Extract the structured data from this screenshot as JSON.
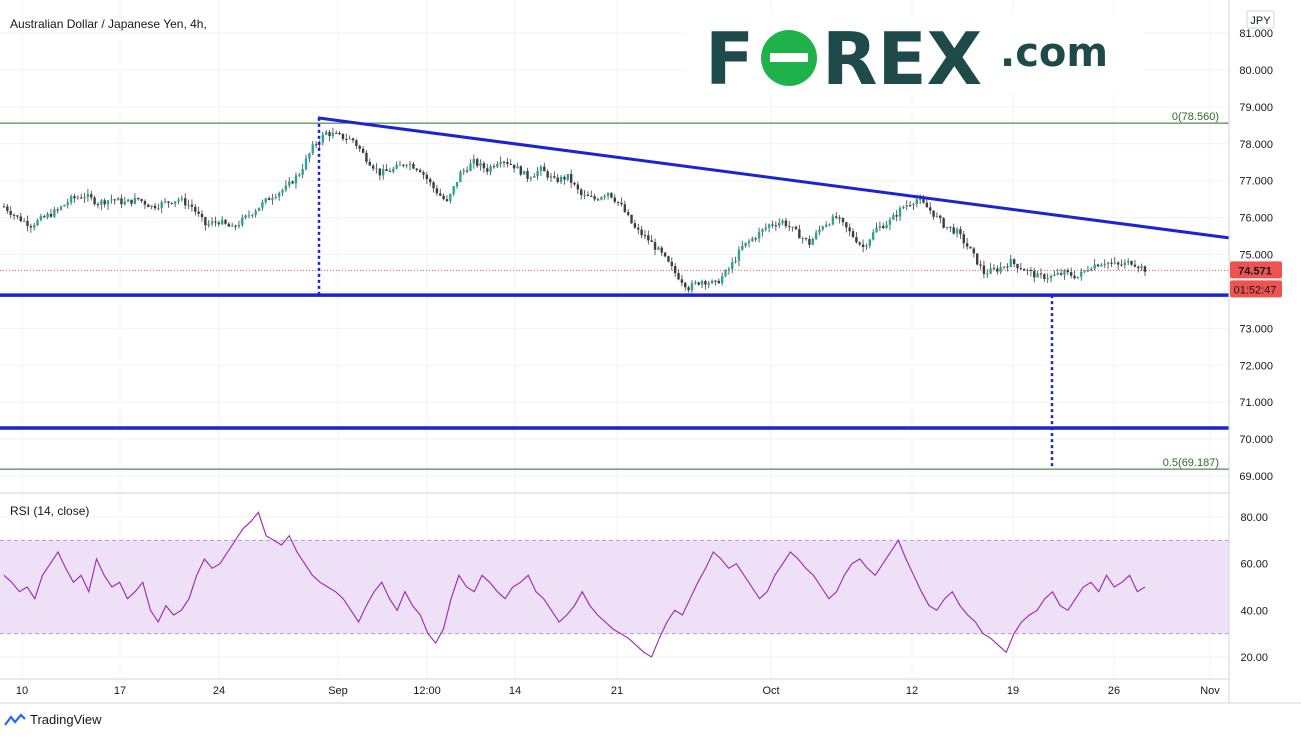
{
  "chart_title": "Australian Dollar / Japanese Yen, 4h,",
  "currency_badge": "JPY",
  "brand": {
    "prefix": "F",
    "o": "O",
    "suffix": "REX",
    "dot_com": ".com",
    "color_dark": "#1f4a4a",
    "color_green": "#1fb24a"
  },
  "footer": {
    "tradingview": "TradingView"
  },
  "colors": {
    "up_candle": "#26a69a",
    "down_candle": "#ef5350",
    "blue_lines": "#1c22d6",
    "fib_lines": "#2e6b2e",
    "rsi_line": "#9c27b0",
    "rsi_band": "#ede0f7",
    "price_tag": "#ef5350"
  },
  "chart_data": [
    {
      "type": "candlestick",
      "symbol": "AUDJPY",
      "timeframe": "4h",
      "ylim": [
        68.8,
        81.3
      ],
      "y_ticks": [
        "81.000",
        "80.000",
        "79.000",
        "78.000",
        "77.000",
        "76.000",
        "75.000",
        "74.000",
        "73.000",
        "72.000",
        "71.000",
        "70.000",
        "69.000"
      ],
      "x_ticks": [
        "10",
        "17",
        "24",
        "Sep",
        "12:00",
        "14",
        "21",
        "Oct",
        "12",
        "19",
        "26",
        "Nov"
      ],
      "current_price": "74.571",
      "countdown": "01:52:47",
      "fib_levels": [
        {
          "label": "0(78.560)",
          "price": 78.56
        },
        {
          "label": "0.5(69.187)",
          "price": 69.187
        }
      ],
      "horizontal_levels": [
        73.9,
        70.3
      ],
      "trendline": {
        "from": [
          "Sep",
          78.7
        ],
        "to": [
          "Nov",
          75.45
        ]
      },
      "price_path": [
        [
          0,
          76.3
        ],
        [
          4,
          76.0
        ],
        [
          8,
          75.8
        ],
        [
          12,
          76.0
        ],
        [
          16,
          76.2
        ],
        [
          20,
          76.5
        ],
        [
          24,
          76.6
        ],
        [
          28,
          76.4
        ],
        [
          32,
          76.5
        ],
        [
          36,
          76.4
        ],
        [
          40,
          76.5
        ],
        [
          44,
          76.3
        ],
        [
          48,
          76.4
        ],
        [
          52,
          76.5
        ],
        [
          56,
          76.3
        ],
        [
          60,
          75.8
        ],
        [
          64,
          75.9
        ],
        [
          68,
          75.7
        ],
        [
          72,
          76.0
        ],
        [
          76,
          76.3
        ],
        [
          80,
          76.6
        ],
        [
          84,
          76.8
        ],
        [
          88,
          77.2
        ],
        [
          92,
          77.9
        ],
        [
          96,
          78.3
        ],
        [
          100,
          78.2
        ],
        [
          104,
          78.1
        ],
        [
          108,
          77.6
        ],
        [
          112,
          77.2
        ],
        [
          116,
          77.3
        ],
        [
          120,
          77.5
        ],
        [
          124,
          77.3
        ],
        [
          128,
          76.8
        ],
        [
          132,
          76.4
        ],
        [
          136,
          77.2
        ],
        [
          140,
          77.5
        ],
        [
          144,
          77.3
        ],
        [
          148,
          77.6
        ],
        [
          152,
          77.4
        ],
        [
          156,
          77.1
        ],
        [
          160,
          77.3
        ],
        [
          164,
          77.0
        ],
        [
          168,
          77.1
        ],
        [
          172,
          76.6
        ],
        [
          176,
          76.5
        ],
        [
          180,
          76.7
        ],
        [
          184,
          76.3
        ],
        [
          188,
          75.7
        ],
        [
          192,
          75.4
        ],
        [
          196,
          75.0
        ],
        [
          200,
          74.5
        ],
        [
          204,
          74.1
        ],
        [
          208,
          74.3
        ],
        [
          212,
          74.2
        ],
        [
          216,
          74.6
        ],
        [
          220,
          75.2
        ],
        [
          224,
          75.5
        ],
        [
          228,
          75.8
        ],
        [
          232,
          75.9
        ],
        [
          236,
          75.6
        ],
        [
          240,
          75.3
        ],
        [
          244,
          75.8
        ],
        [
          248,
          76.0
        ],
        [
          252,
          75.6
        ],
        [
          256,
          75.2
        ],
        [
          260,
          75.7
        ],
        [
          264,
          75.9
        ],
        [
          268,
          76.3
        ],
        [
          272,
          76.5
        ],
        [
          276,
          76.2
        ],
        [
          280,
          75.8
        ],
        [
          284,
          75.6
        ],
        [
          288,
          75.1
        ],
        [
          292,
          74.5
        ],
        [
          296,
          74.6
        ],
        [
          300,
          74.8
        ],
        [
          304,
          74.6
        ],
        [
          308,
          74.4
        ],
        [
          312,
          74.4
        ],
        [
          316,
          74.5
        ],
        [
          320,
          74.4
        ],
        [
          324,
          74.7
        ],
        [
          328,
          74.8
        ],
        [
          332,
          74.7
        ],
        [
          336,
          74.8
        ],
        [
          340,
          74.6
        ]
      ]
    },
    {
      "type": "line",
      "title": "RSI (14, close)",
      "ylim": [
        15,
        85
      ],
      "y_ticks": [
        "80.00",
        "60.00",
        "40.00",
        "20.00"
      ],
      "band": [
        30,
        70
      ],
      "values": [
        55,
        52,
        48,
        50,
        45,
        55,
        60,
        65,
        58,
        52,
        55,
        48,
        62,
        55,
        50,
        52,
        45,
        48,
        52,
        40,
        35,
        42,
        38,
        40,
        45,
        55,
        62,
        58,
        60,
        65,
        70,
        75,
        78,
        82,
        72,
        70,
        68,
        72,
        65,
        60,
        55,
        52,
        50,
        48,
        45,
        40,
        35,
        42,
        48,
        52,
        45,
        40,
        48,
        42,
        38,
        30,
        26,
        32,
        45,
        55,
        50,
        48,
        55,
        52,
        48,
        45,
        50,
        52,
        55,
        48,
        45,
        40,
        35,
        38,
        42,
        48,
        42,
        38,
        35,
        32,
        30,
        28,
        25,
        22,
        20,
        28,
        35,
        40,
        38,
        45,
        52,
        58,
        65,
        62,
        58,
        60,
        55,
        50,
        45,
        48,
        55,
        60,
        65,
        62,
        58,
        55,
        50,
        45,
        48,
        55,
        60,
        62,
        58,
        55,
        60,
        65,
        70,
        62,
        55,
        48,
        42,
        40,
        45,
        48,
        42,
        38,
        35,
        30,
        28,
        25,
        22,
        30,
        35,
        38,
        40,
        45,
        48,
        42,
        40,
        45,
        50,
        52,
        48,
        55,
        50,
        52,
        55,
        48,
        50
      ]
    }
  ]
}
